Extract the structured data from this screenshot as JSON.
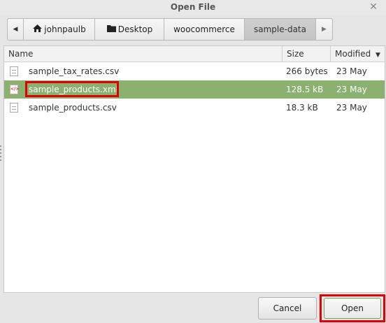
{
  "window": {
    "title": "Open File",
    "close_glyph": "✕"
  },
  "pathbar": {
    "back_glyph": "◀",
    "forward_glyph": "▶",
    "home_icon": "home-icon",
    "folder_icon": "folder-icon",
    "segments": [
      {
        "label": "johnpaulb",
        "icon": "home-icon"
      },
      {
        "label": "Desktop",
        "icon": "folder-icon"
      },
      {
        "label": "woocommerce"
      },
      {
        "label": "sample-data",
        "active": true
      }
    ]
  },
  "columns": {
    "name": "Name",
    "size": "Size",
    "modified": "Modified",
    "sort_glyph": "▼"
  },
  "files": [
    {
      "name": "sample_tax_rates.csv",
      "size": "266 bytes",
      "modified": "23 May",
      "icon": "text-file-icon"
    },
    {
      "name": "sample_products.xml",
      "size": "128.5 kB",
      "modified": "23 May",
      "icon": "xml-file-icon",
      "selected": true
    },
    {
      "name": "sample_products.csv",
      "size": "18.3 kB",
      "modified": "23 May",
      "icon": "text-file-icon"
    }
  ],
  "buttons": {
    "cancel": "Cancel",
    "open": "Open"
  },
  "colors": {
    "selection": "#8ab170",
    "highlight": "#e00000"
  }
}
